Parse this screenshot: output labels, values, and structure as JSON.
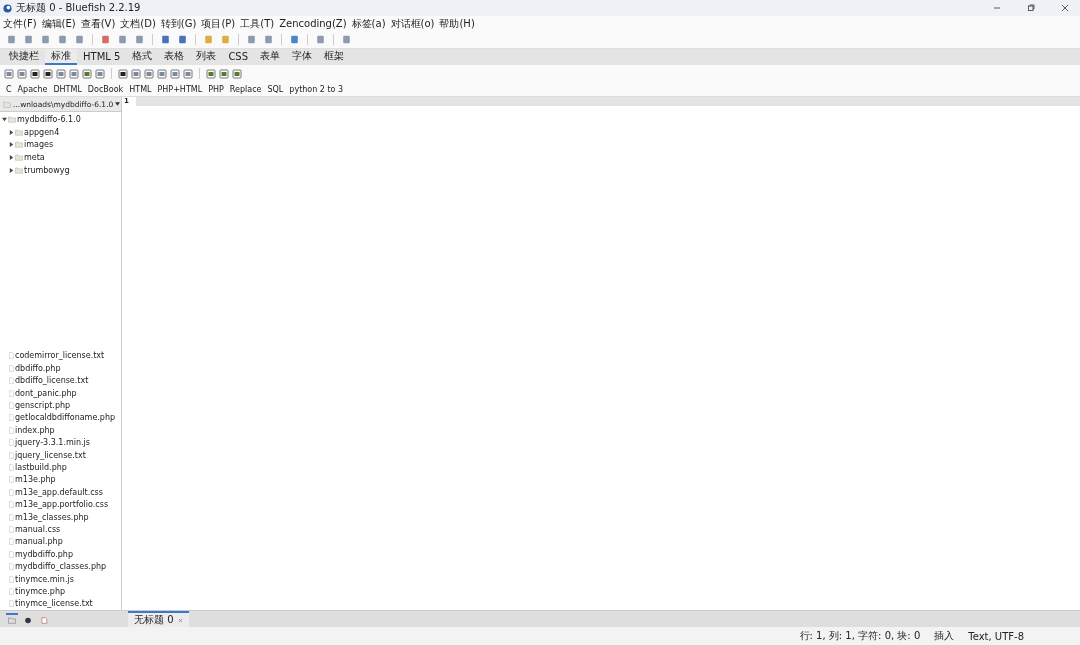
{
  "window": {
    "title": "无标题 0 - Bluefish 2.2.19"
  },
  "menu": [
    "文件(F)",
    "编辑(E)",
    "查看(V)",
    "文档(D)",
    "转到(G)",
    "项目(P)",
    "工具(T)",
    "Zencoding(Z)",
    "标签(a)",
    "对话框(o)",
    "帮助(H)"
  ],
  "toolbar_tabs": [
    {
      "label": "快捷栏",
      "selected": false
    },
    {
      "label": "标准",
      "selected": true
    },
    {
      "label": "HTML 5",
      "selected": false
    },
    {
      "label": "格式",
      "selected": false
    },
    {
      "label": "表格",
      "selected": false
    },
    {
      "label": "列表",
      "selected": false
    },
    {
      "label": "CSS",
      "selected": false
    },
    {
      "label": "表单",
      "selected": false
    },
    {
      "label": "字体",
      "selected": false
    },
    {
      "label": "框架",
      "selected": false
    }
  ],
  "snippets": [
    "C",
    "Apache",
    "DHTML",
    "DocBook",
    "HTML",
    "PHP+HTML",
    "PHP",
    "Replace",
    "SQL",
    "python 2 to 3"
  ],
  "sidebar": {
    "path": "...wnloads\\mydbdiffo-6.1.0",
    "tree": [
      {
        "name": "mydbdiffo-6.1.0",
        "expanded": true,
        "children": [
          {
            "name": "appgen4",
            "expanded": false
          },
          {
            "name": "images",
            "expanded": false
          },
          {
            "name": "meta",
            "expanded": false
          },
          {
            "name": "trumbowyg",
            "expanded": false
          }
        ]
      }
    ],
    "files": [
      "codemirror_license.txt",
      "dbdiffo.php",
      "dbdiffo_license.txt",
      "dont_panic.php",
      "genscript.php",
      "getlocaldbdiffoname.php",
      "index.php",
      "jquery-3.3.1.min.js",
      "jquery_license.txt",
      "lastbuild.php",
      "m13e.php",
      "m13e_app.default.css",
      "m13e_app.portfolio.css",
      "m13e_classes.php",
      "manual.css",
      "manual.php",
      "mydbdiffo.php",
      "mydbdiffo_classes.php",
      "tinymce.min.js",
      "tinymce.php",
      "tinymce_license.txt"
    ]
  },
  "editor": {
    "line_numbers": [
      "1"
    ]
  },
  "document_tabs": [
    {
      "label": "无标题 0",
      "selected": true
    }
  ],
  "status_bar": {
    "position": "行: 1, 列: 1, 字符: 0, 块: 0",
    "mode": "插入",
    "encoding": "Text, UTF-8"
  }
}
